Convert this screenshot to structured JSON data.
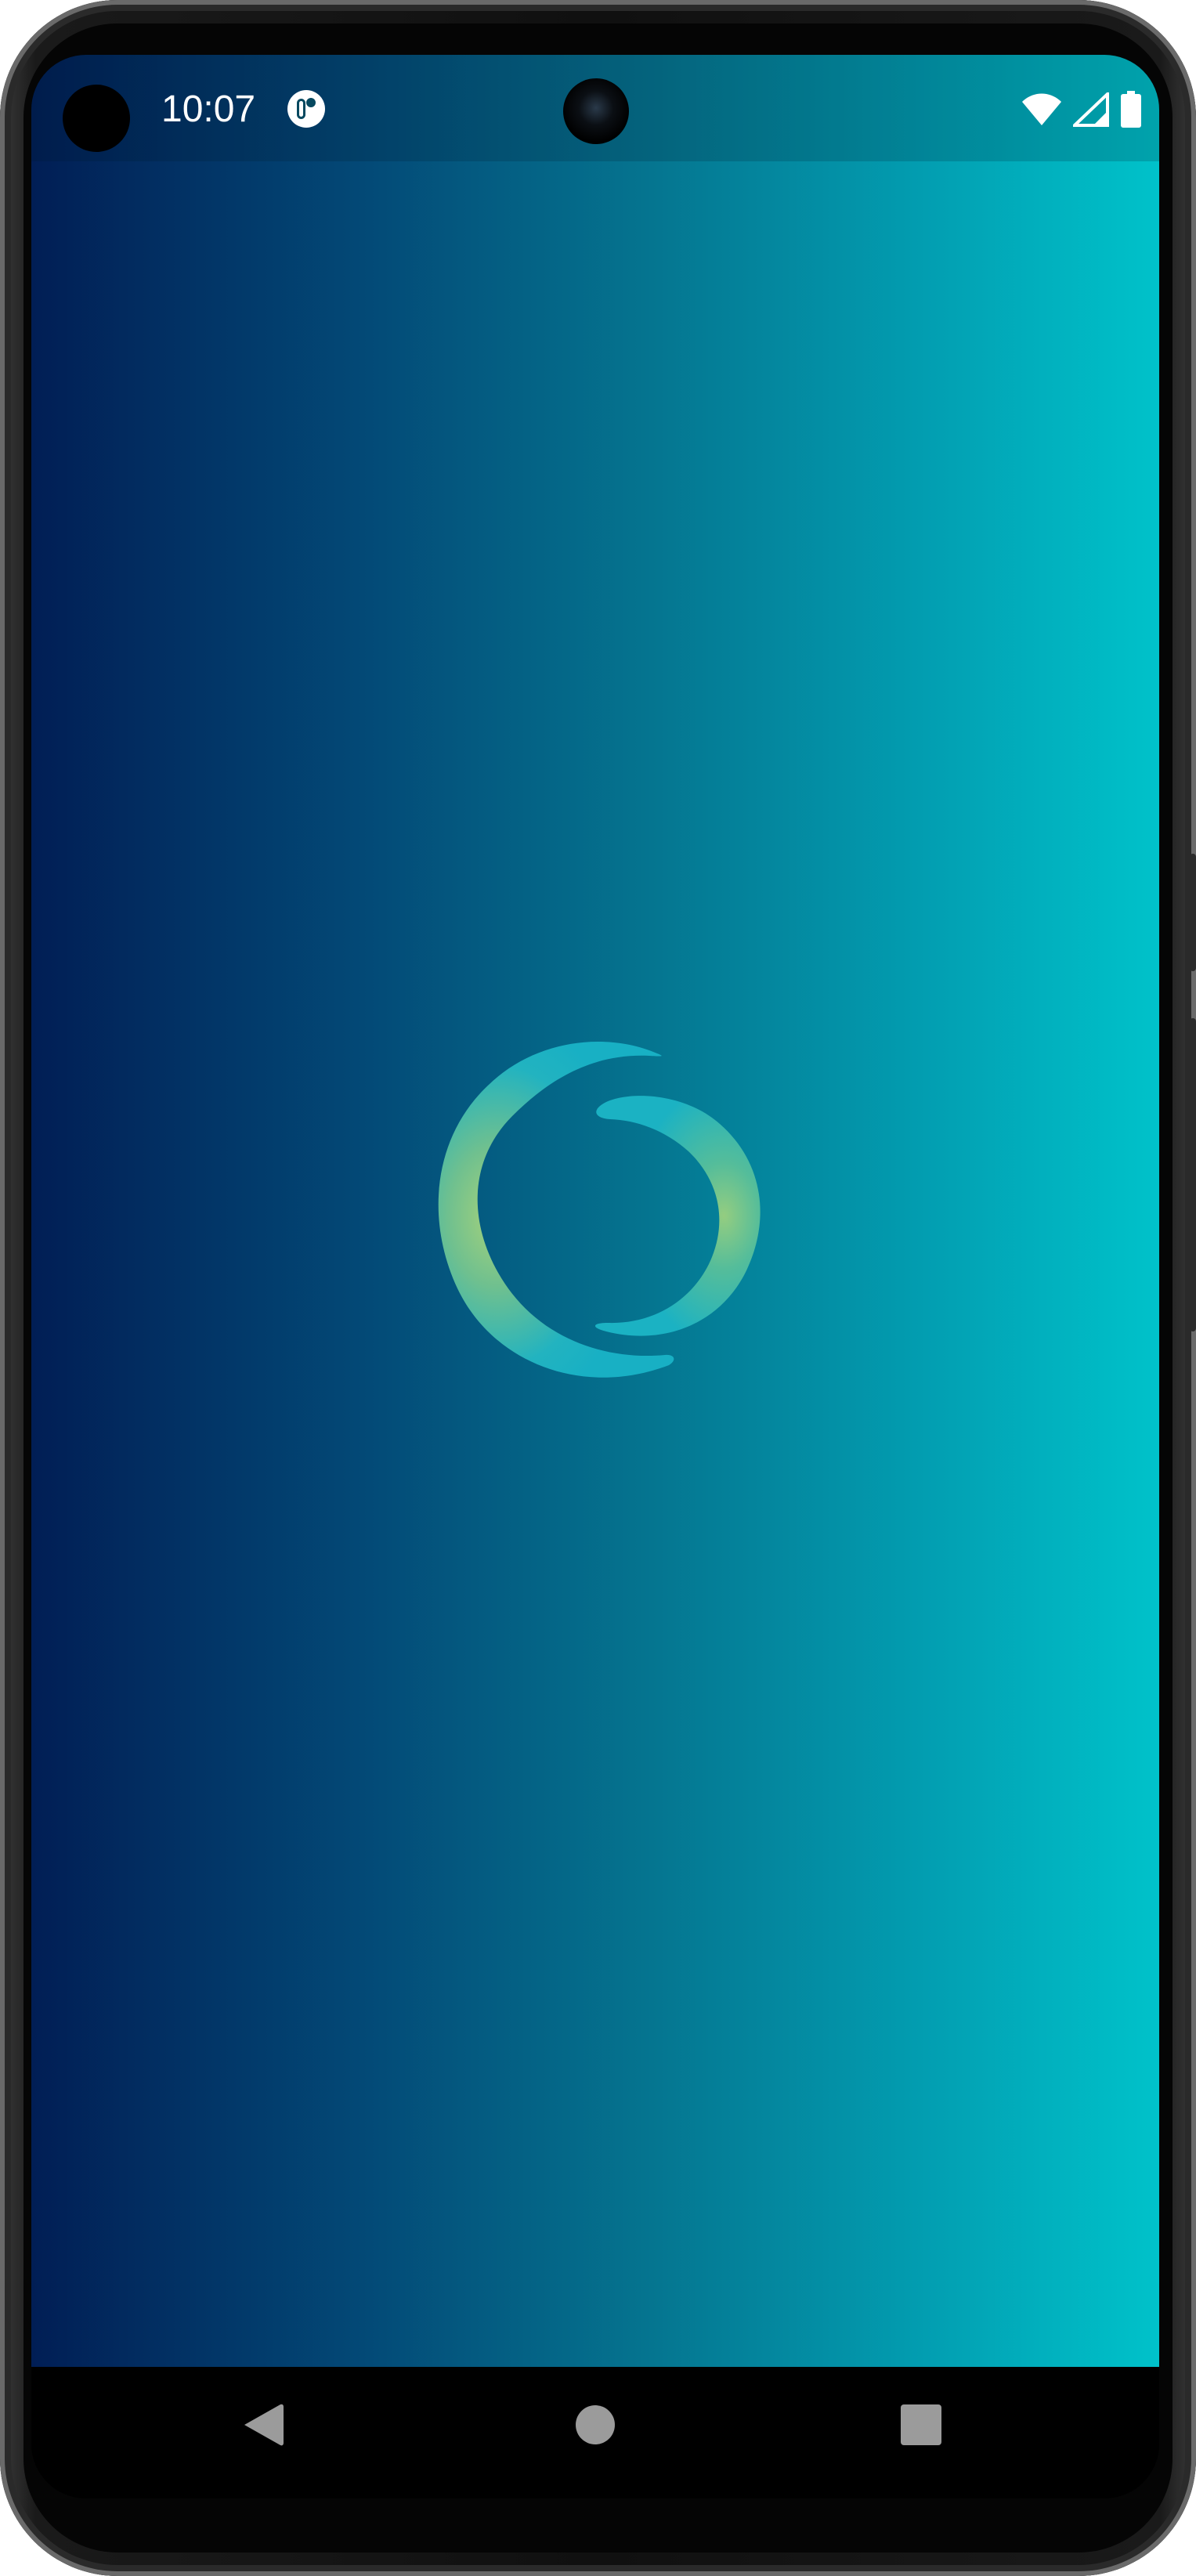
{
  "status_bar": {
    "time": "10:07",
    "notification_icon": "app-notification-icon",
    "icons": [
      "wifi-icon",
      "cell-signal-icon",
      "battery-icon"
    ]
  },
  "splash": {
    "logo_icon": "crescent-rings-logo"
  },
  "navigation": {
    "buttons": [
      "back-icon",
      "home-icon",
      "recents-icon"
    ]
  },
  "colors": {
    "gradient_left": "#011e55",
    "gradient_right": "#00c2ca",
    "logo_teal": "#1fb5c2",
    "logo_green": "#8dc87d",
    "nav_bar": "#000000",
    "nav_icon": "#9b9b9b"
  }
}
